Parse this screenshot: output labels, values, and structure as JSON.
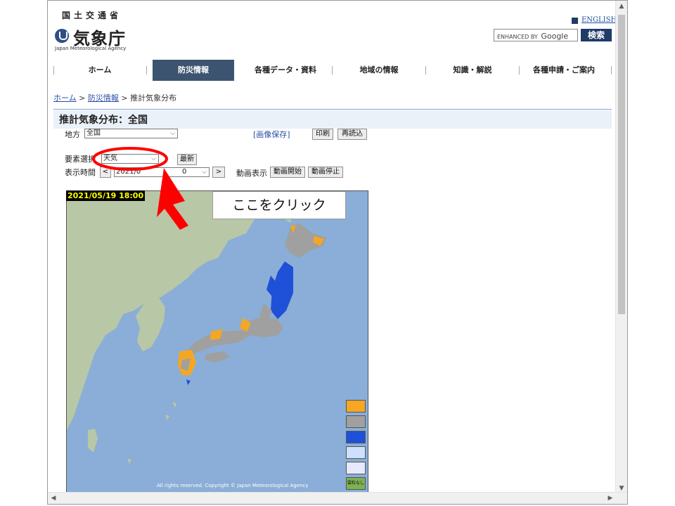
{
  "header": {
    "ministry": "国土交通省",
    "logo_text": "気象庁",
    "logo_en": "Japan Meteorological Agency",
    "english_link": "ENGLISH",
    "search_placeholder": "ENHANCED BY",
    "search_google": "Google",
    "search_button": "検索"
  },
  "nav": [
    {
      "label": "ホーム",
      "active": false
    },
    {
      "label": "防災情報",
      "active": true
    },
    {
      "label": "各種データ・資料",
      "active": false
    },
    {
      "label": "地域の情報",
      "active": false
    },
    {
      "label": "知識・解説",
      "active": false
    },
    {
      "label": "各種申請・ご案内",
      "active": false
    }
  ],
  "breadcrumb": {
    "home": "ホーム",
    "sep1": ">",
    "section": "防災情報",
    "sep2": ">",
    "current": "推計気象分布"
  },
  "page_title": "推計気象分布：全国",
  "controls": {
    "region_label": "地方",
    "region_value": "全国",
    "save_image": "[画像保存]",
    "print": "印刷",
    "reload": "再読込",
    "element_label": "要素選択",
    "element_value": "天気",
    "latest": "最新",
    "time_label": "表示時間",
    "prev": "<",
    "time_value": "2021/0",
    "time_value_tail": "0",
    "next": ">",
    "anim_label": "動画表示",
    "anim_start": "動画開始",
    "anim_stop": "動画停止"
  },
  "map": {
    "timestamp": "2021/05/19 18:00",
    "copyright": "All rights reserved. Copyright © Japan Meteorological Agency",
    "legend_none": "雲粒なし"
  },
  "annotation": {
    "callout": "ここをクリック",
    "color": "#ff0000"
  },
  "colors": {
    "nav_active": "#3c5470",
    "sea": "#8aaed7",
    "land": "#b8c7a6",
    "sunny": "#f5a623",
    "cloudy": "#a0a0a0",
    "rain": "#1f50d8"
  }
}
